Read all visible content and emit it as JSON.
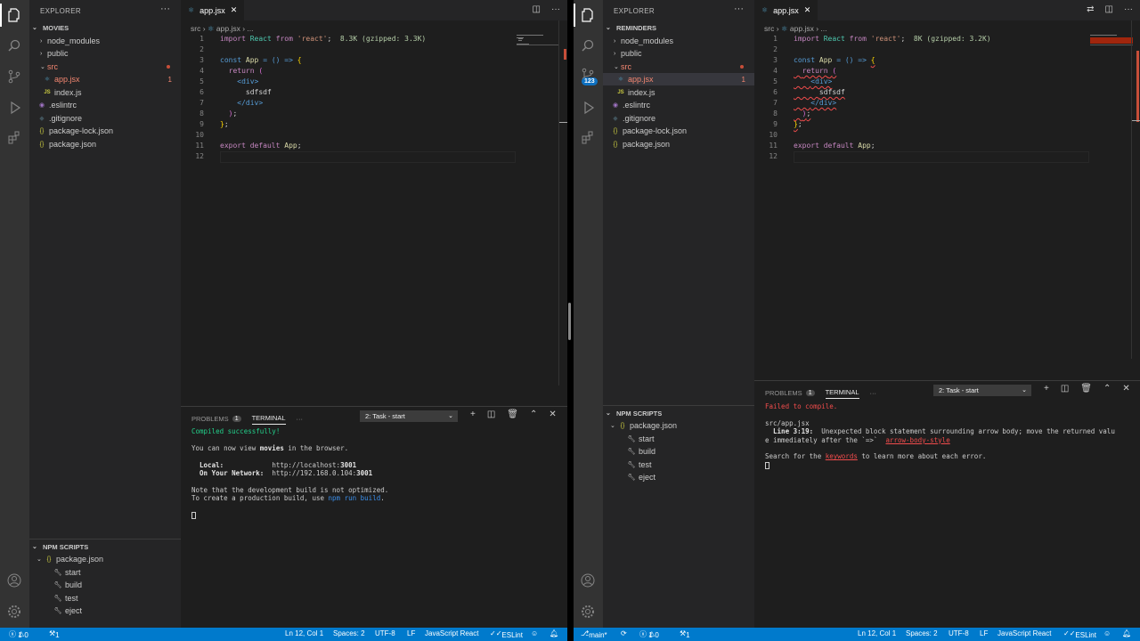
{
  "left": {
    "explorer_title": "EXPLORER",
    "folder": "MOVIES",
    "files": [
      {
        "label": "node_modules",
        "kind": "folder"
      },
      {
        "label": "public",
        "kind": "folder"
      },
      {
        "label": "src",
        "kind": "folder-open"
      },
      {
        "label": "app.jsx",
        "kind": "jsx",
        "count": "1"
      },
      {
        "label": "index.js",
        "kind": "js"
      },
      {
        "label": ".eslintrc",
        "kind": "eslint"
      },
      {
        "label": ".gitignore",
        "kind": "git"
      },
      {
        "label": "package-lock.json",
        "kind": "json"
      },
      {
        "label": "package.json",
        "kind": "json"
      }
    ],
    "npm_title": "NPM SCRIPTS",
    "npm_file": "package.json",
    "scripts": [
      "start",
      "build",
      "test",
      "eject"
    ],
    "tab": "app.jsx",
    "breadcrumb_folder": "src",
    "breadcrumb_file": "app.jsx",
    "breadcrumb_more": "...",
    "import_size": "8.3K (gzipped: 3.3K)",
    "panel_tab_problems": "PROBLEMS",
    "panel_problems_count": "1",
    "panel_tab_terminal": "TERMINAL",
    "task_select": "2: Task - start",
    "terminal": {
      "compiled": "Compiled successfully!",
      "view_pre": "You can now view ",
      "view_app": "movies",
      "view_post": " in the browser.",
      "local_label": "  Local:",
      "local_url_pre": "http://localhost:",
      "local_port": "3001",
      "network_label": "  On Your Network:",
      "network_url_pre": "http://192.168.0.104:",
      "network_port": "3001",
      "note1": "Note that the development build is not optimized.",
      "note2_pre": "To create a production build, use ",
      "note2_cmd": "npm run build",
      "note2_post": "."
    },
    "status": {
      "errors": "1",
      "warnings": "0",
      "ports": "1",
      "position": "Ln 12, Col 1",
      "spaces": "Spaces: 2",
      "encoding": "UTF-8",
      "eol": "LF",
      "language": "JavaScript React",
      "linter": "ESLint"
    }
  },
  "right": {
    "explorer_title": "EXPLORER",
    "folder": "REMINDERS",
    "source_control_badge": "123",
    "files": [
      {
        "label": "node_modules",
        "kind": "folder"
      },
      {
        "label": "public",
        "kind": "folder"
      },
      {
        "label": "src",
        "kind": "folder-open"
      },
      {
        "label": "app.jsx",
        "kind": "jsx",
        "count": "1"
      },
      {
        "label": "index.js",
        "kind": "js"
      },
      {
        "label": ".eslintrc",
        "kind": "eslint"
      },
      {
        "label": ".gitignore",
        "kind": "git"
      },
      {
        "label": "package-lock.json",
        "kind": "json"
      },
      {
        "label": "package.json",
        "kind": "json"
      }
    ],
    "npm_title": "NPM SCRIPTS",
    "npm_file": "package.json",
    "scripts": [
      "start",
      "build",
      "test",
      "eject"
    ],
    "tab": "app.jsx",
    "breadcrumb_folder": "src",
    "breadcrumb_file": "app.jsx",
    "breadcrumb_more": "...",
    "import_size": "8K (gzipped: 3.2K)",
    "panel_tab_problems": "PROBLEMS",
    "panel_problems_count": "1",
    "panel_tab_terminal": "TERMINAL",
    "task_select": "2: Task - start",
    "terminal": {
      "failed": "Failed to compile.",
      "file": "src/app.jsx",
      "line_label": "  Line 3:19:",
      "msg1": "  Unexpected block statement surrounding arrow body; move the returned valu",
      "msg2_pre": "e immediately after the `=>`  ",
      "rule": "arrow-body-style",
      "search_pre": "Search for the ",
      "search_kw": "keywords",
      "search_post": " to learn more about each error."
    },
    "status": {
      "branch": "main*",
      "errors": "1",
      "warnings": "0",
      "ports": "1",
      "position": "Ln 12, Col 1",
      "spaces": "Spaces: 2",
      "encoding": "UTF-8",
      "eol": "LF",
      "language": "JavaScript React",
      "linter": "ESLint"
    }
  },
  "code": {
    "l1_import": "import",
    "l1_react": "React",
    "l1_from": "from",
    "l1_str": "'react'",
    "l3_const": "const",
    "l3_app": "App",
    "l3_rest": "= () =>",
    "l4_return": "return",
    "l5_tag_open": "<div>",
    "l6_text": "sdfsdf",
    "l7_tag_close": "</div>",
    "l11_export": "export default",
    "l11_app": "App",
    "line_numbers": [
      "1",
      "2",
      "3",
      "4",
      "5",
      "6",
      "7",
      "8",
      "9",
      "10",
      "11",
      "12"
    ]
  },
  "colors": {
    "statusbar": "#007acc",
    "error": "#f14c4c",
    "success": "#23d18b"
  }
}
